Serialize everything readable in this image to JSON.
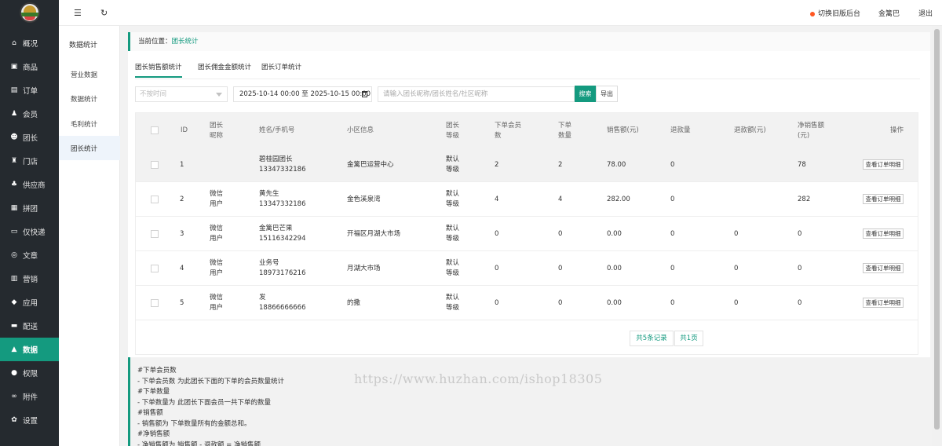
{
  "sidebar": {
    "items": [
      {
        "label": "概况",
        "icon": "home-icon"
      },
      {
        "label": "商品",
        "icon": "box-icon"
      },
      {
        "label": "订单",
        "icon": "order-icon"
      },
      {
        "label": "会员",
        "icon": "members-icon"
      },
      {
        "label": "团长",
        "icon": "leader-icon"
      },
      {
        "label": "门店",
        "icon": "store-icon"
      },
      {
        "label": "供应商",
        "icon": "supplier-icon"
      },
      {
        "label": "拼团",
        "icon": "group-buy-icon"
      },
      {
        "label": "仅快递",
        "icon": "express-icon"
      },
      {
        "label": "文章",
        "icon": "article-icon"
      },
      {
        "label": "营销",
        "icon": "marketing-icon"
      },
      {
        "label": "应用",
        "icon": "apps-icon"
      },
      {
        "label": "配送",
        "icon": "delivery-icon"
      },
      {
        "label": "数据",
        "icon": "chart-icon"
      },
      {
        "label": "权限",
        "icon": "permission-icon"
      },
      {
        "label": "附件",
        "icon": "attachment-icon"
      },
      {
        "label": "设置",
        "icon": "gear-icon"
      }
    ]
  },
  "subnav": {
    "title": "数据统计",
    "items": [
      "营业数据",
      "数据统计",
      "毛利统计",
      "团长统计"
    ]
  },
  "topbar": {
    "switch_label": "切换旧版后台",
    "user": "金篱巴",
    "logout": "退出"
  },
  "breadcrumb": {
    "prefix": "当前位置：",
    "current": "团长统计"
  },
  "tabs": [
    "团长销售额统计",
    "团长佣金金额统计",
    "团长订单统计"
  ],
  "filters": {
    "time_select": "不按时间",
    "date_range": "2025-10-14 00:00 至 2025-10-15 00:00",
    "search_placeholder": "请输入团长昵称/团长姓名/社区昵称",
    "search_button": "搜索",
    "export_button": "导出"
  },
  "table": {
    "headers": {
      "id": "ID",
      "nickname": [
        "团长",
        "昵称"
      ],
      "name": "姓名/手机号",
      "community": "小区信息",
      "level": [
        "团长",
        "等级"
      ],
      "members": [
        "下单会员",
        "数"
      ],
      "orders": [
        "下单",
        "数量"
      ],
      "sales": "销售额(元)",
      "refund_qty": "退款量",
      "refund_amt": "退款额(元)",
      "net_sales": [
        "净销售额",
        "(元)"
      ],
      "action": "操作"
    },
    "detail_button": "查看订单明细",
    "rows": [
      {
        "id": "1",
        "nickname": [
          "",
          ""
        ],
        "name": "碧桂园团长",
        "phone": "13347332186",
        "community": "金篱巴运营中心",
        "level": [
          "默认",
          "等级"
        ],
        "members": "2",
        "orders": "2",
        "sales": "78.00",
        "refund_qty": "0",
        "refund_amt": "",
        "net_sales": "78"
      },
      {
        "id": "2",
        "nickname": [
          "微信",
          "用户"
        ],
        "name": "黄先生",
        "phone": "13347332186",
        "community": "金色溪泉湾",
        "level": [
          "默认",
          "等级"
        ],
        "members": "4",
        "orders": "4",
        "sales": "282.00",
        "refund_qty": "0",
        "refund_amt": "",
        "net_sales": "282"
      },
      {
        "id": "3",
        "nickname": [
          "微信",
          "用户"
        ],
        "name": "金篱巴芒果",
        "phone": "15116342294",
        "community": "开福区月湖大市场",
        "level": [
          "默认",
          "等级"
        ],
        "members": "0",
        "orders": "0",
        "sales": "0.00",
        "refund_qty": "0",
        "refund_amt": "0",
        "net_sales": "0"
      },
      {
        "id": "4",
        "nickname": [
          "微信",
          "用户"
        ],
        "name": "业务号",
        "phone": "18973176216",
        "community": "月湖大市场",
        "level": [
          "默认",
          "等级"
        ],
        "members": "0",
        "orders": "0",
        "sales": "0.00",
        "refund_qty": "0",
        "refund_amt": "0",
        "net_sales": "0"
      },
      {
        "id": "5",
        "nickname": [
          "微信",
          "用户"
        ],
        "name": "发",
        "phone": "18866666666",
        "community": "的撒",
        "level": [
          "默认",
          "等级"
        ],
        "members": "0",
        "orders": "0",
        "sales": "0.00",
        "refund_qty": "0",
        "refund_amt": "0",
        "net_sales": "0"
      }
    ],
    "total_records": "共5条记录",
    "total_pages": "共1页"
  },
  "notes": [
    "#下单会员数",
    "- 下单会员数 为此团长下面的下单的会员数量统计",
    "#下单数量",
    "- 下单数量为 此团长下面会员一共下单的数量",
    "#销售额",
    "- 销售额为 下单数量所有的金额总和。",
    "#净销售额",
    "- 净销售额为 销售额 - 退款额 = 净销售额"
  ],
  "watermark": "https://www.huzhan.com/ishop18305",
  "colors": {
    "accent": "#149a7f",
    "sidebar": "#252a2f",
    "alert_dot": "#ff5722"
  }
}
